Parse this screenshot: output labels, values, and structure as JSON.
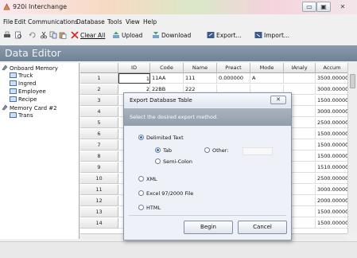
{
  "window": {
    "title": "920i Interchange",
    "minimize_label": "▭",
    "maximize_label": "▣",
    "close_label": "✕"
  },
  "menu": [
    "File",
    "Edit",
    "Communications",
    "Database",
    "Tools",
    "View",
    "Help"
  ],
  "toolbar": {
    "clear_all": "Clear All",
    "upload": "Upload",
    "download": "Download",
    "export": "Export...",
    "import": "Import..."
  },
  "header": {
    "title": "Data Editor"
  },
  "tree": {
    "onboard": "Onboard Memory",
    "onboard_children": [
      "Truck",
      "Ingred",
      "Employee",
      "Recipe"
    ],
    "card": "Memory Card #2",
    "card_children": [
      "Trans"
    ]
  },
  "grid": {
    "columns": [
      "ID",
      "Code",
      "Name",
      "Preact",
      "Mode",
      "IAnaly",
      "Accum"
    ],
    "rows": [
      {
        "num": "1",
        "id": "1",
        "code": "11AA",
        "name": "111",
        "preact": "0.000000",
        "mode": "A",
        "ianaly": "",
        "accum": "3500.000000"
      },
      {
        "num": "2",
        "id": "2",
        "code": "22BB",
        "name": "222",
        "preact": "",
        "mode": "",
        "ianaly": "",
        "accum": "3000.000000"
      },
      {
        "num": "3",
        "id": "",
        "code": "",
        "name": "",
        "preact": "",
        "mode": "",
        "ianaly": "",
        "accum": "1500.000000"
      },
      {
        "num": "4",
        "id": "",
        "code": "",
        "name": "",
        "preact": "",
        "mode": "",
        "ianaly": "",
        "accum": "3000.000000"
      },
      {
        "num": "5",
        "id": "",
        "code": "",
        "name": "",
        "preact": "",
        "mode": "",
        "ianaly": "",
        "accum": "2500.000000"
      },
      {
        "num": "6",
        "id": "",
        "code": "",
        "name": "",
        "preact": "",
        "mode": "",
        "ianaly": "",
        "accum": "1500.000000"
      },
      {
        "num": "7",
        "id": "",
        "code": "",
        "name": "",
        "preact": "",
        "mode": "",
        "ianaly": "",
        "accum": "1500.000000"
      },
      {
        "num": "8",
        "id": "",
        "code": "",
        "name": "",
        "preact": "",
        "mode": "",
        "ianaly": "",
        "accum": "1500.000000"
      },
      {
        "num": "9",
        "id": "",
        "code": "",
        "name": "",
        "preact": "",
        "mode": "",
        "ianaly": "",
        "accum": "1510.000000"
      },
      {
        "num": "10",
        "id": "",
        "code": "",
        "name": "",
        "preact": "",
        "mode": "",
        "ianaly": "",
        "accum": "2500.000000"
      },
      {
        "num": "11",
        "id": "",
        "code": "",
        "name": "",
        "preact": "",
        "mode": "",
        "ianaly": "",
        "accum": "3000.000000"
      },
      {
        "num": "12",
        "id": "",
        "code": "",
        "name": "",
        "preact": "",
        "mode": "",
        "ianaly": "",
        "accum": "2000.000000"
      },
      {
        "num": "13",
        "id": "",
        "code": "",
        "name": "",
        "preact": "",
        "mode": "",
        "ianaly": "",
        "accum": "1500.000000"
      },
      {
        "num": "14",
        "id": "",
        "code": "",
        "name": "",
        "preact": "",
        "mode": "",
        "ianaly": "",
        "accum": "1500.000000"
      }
    ]
  },
  "dialog": {
    "title": "Export Database Table",
    "close_label": "✕",
    "banner": "Select the desired export method.",
    "options": {
      "delimited": "Delimited Text",
      "tab": "Tab",
      "other": "Other:",
      "semicolon": "Semi-Colon",
      "xml": "XML",
      "excel": "Excel 97/2000 File",
      "html": "HTML"
    },
    "begin": "Begin",
    "cancel": "Cancel"
  }
}
